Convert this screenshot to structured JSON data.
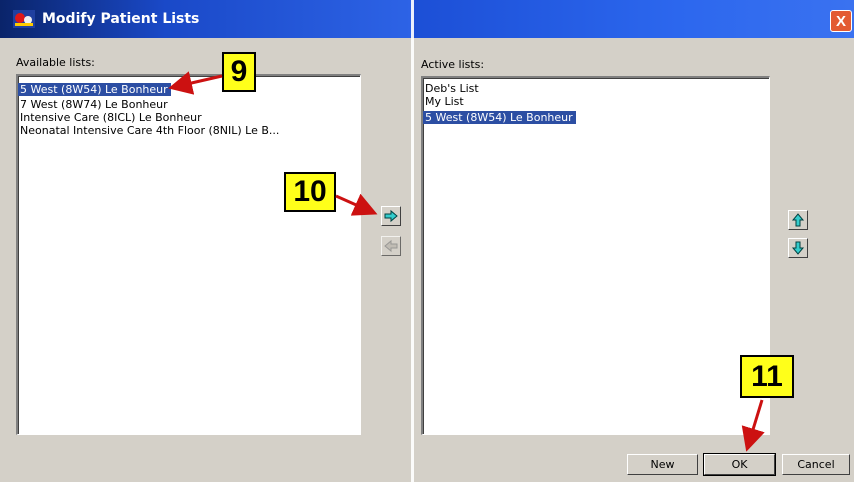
{
  "window": {
    "title": "Modify Patient Lists",
    "close_label": "X"
  },
  "available": {
    "label": "Available lists:",
    "items": [
      {
        "text": "5 West (8W54) Le Bonheur",
        "selected": true
      },
      {
        "text": "7 West (8W74) Le Bonheur",
        "selected": false
      },
      {
        "text": "Intensive Care (8ICL) Le Bonheur",
        "selected": false
      },
      {
        "text": "Neonatal Intensive Care 4th Floor (8NIL)  Le B...",
        "selected": false
      }
    ]
  },
  "active": {
    "label": "Active lists:",
    "items": [
      {
        "text": "Deb's List",
        "selected": false
      },
      {
        "text": "My List",
        "selected": false
      },
      {
        "text": "5 West (8W54) Le Bonheur",
        "selected": true
      }
    ]
  },
  "buttons": {
    "new": "New",
    "ok": "OK",
    "cancel": "Cancel"
  },
  "icons": {
    "move_right": "arrow-right-icon",
    "move_left": "arrow-left-icon",
    "move_up": "arrow-up-icon",
    "move_down": "arrow-down-icon"
  },
  "callouts": {
    "c9": "9",
    "c10": "10",
    "c11": "11"
  },
  "colors": {
    "selection": "#2c4ea3",
    "callout_bg": "#ffff1a",
    "arrow": "#cc1111",
    "arrow_icon": "#33cccc"
  }
}
